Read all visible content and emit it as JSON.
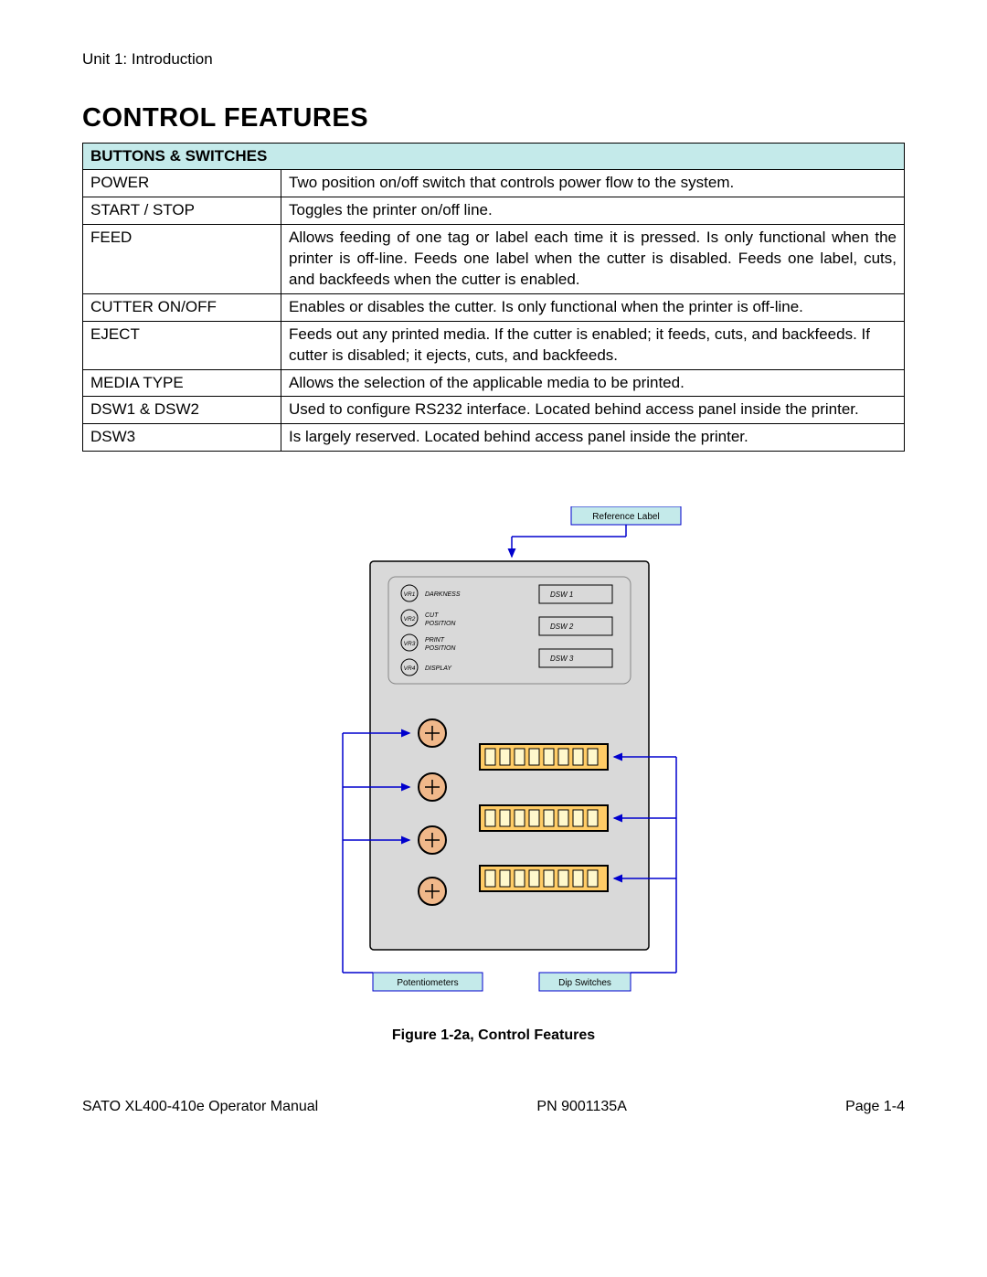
{
  "unit_header": "Unit 1: Introduction",
  "title": "CONTROL FEATURES",
  "table": {
    "header": "BUTTONS & SWITCHES",
    "rows": [
      {
        "name": "POWER",
        "desc": "Two position on/off switch that controls power flow to the system."
      },
      {
        "name": "START / STOP",
        "desc": "Toggles the printer on/off line."
      },
      {
        "name": "FEED",
        "desc": "Allows feeding of one tag or label each time it is pressed. Is only functional when the printer is off-line. Feeds one label when the cutter is disabled. Feeds one label, cuts, and backfeeds when the cutter is enabled.",
        "justify": true
      },
      {
        "name": "CUTTER ON/OFF",
        "desc": "Enables or disables the cutter. Is only functional when the printer is off-line."
      },
      {
        "name": "EJECT",
        "desc": "Feeds out any printed media. If the cutter is enabled; it feeds, cuts, and backfeeds. If cutter is disabled; it ejects, cuts, and backfeeds."
      },
      {
        "name": "MEDIA TYPE",
        "desc": "Allows the selection of the applicable media to be printed."
      },
      {
        "name": "DSW1 & DSW2",
        "desc": "Used to configure RS232 interface. Located behind access panel inside the printer.",
        "justify": true
      },
      {
        "name": "DSW3",
        "desc": "Is largely reserved. Located behind access panel inside the printer."
      }
    ]
  },
  "diagram": {
    "ref_label": "Reference Label",
    "vr": [
      {
        "tag": "VR1",
        "label": "DARKNESS"
      },
      {
        "tag": "VR2",
        "label": "CUT\nPOSITION"
      },
      {
        "tag": "VR3",
        "label": "PRINT\nPOSITION"
      },
      {
        "tag": "VR4",
        "label": "DISPLAY"
      }
    ],
    "dsw": [
      "DSW 1",
      "DSW 2",
      "DSW 3"
    ],
    "bottom_left": "Potentiometers",
    "bottom_right": "Dip Switches"
  },
  "figure_caption": "Figure 1-2a, Control Features",
  "footer": {
    "left": "SATO XL400-410e Operator Manual",
    "center": "PN  9001135A",
    "right": "Page 1-4"
  }
}
